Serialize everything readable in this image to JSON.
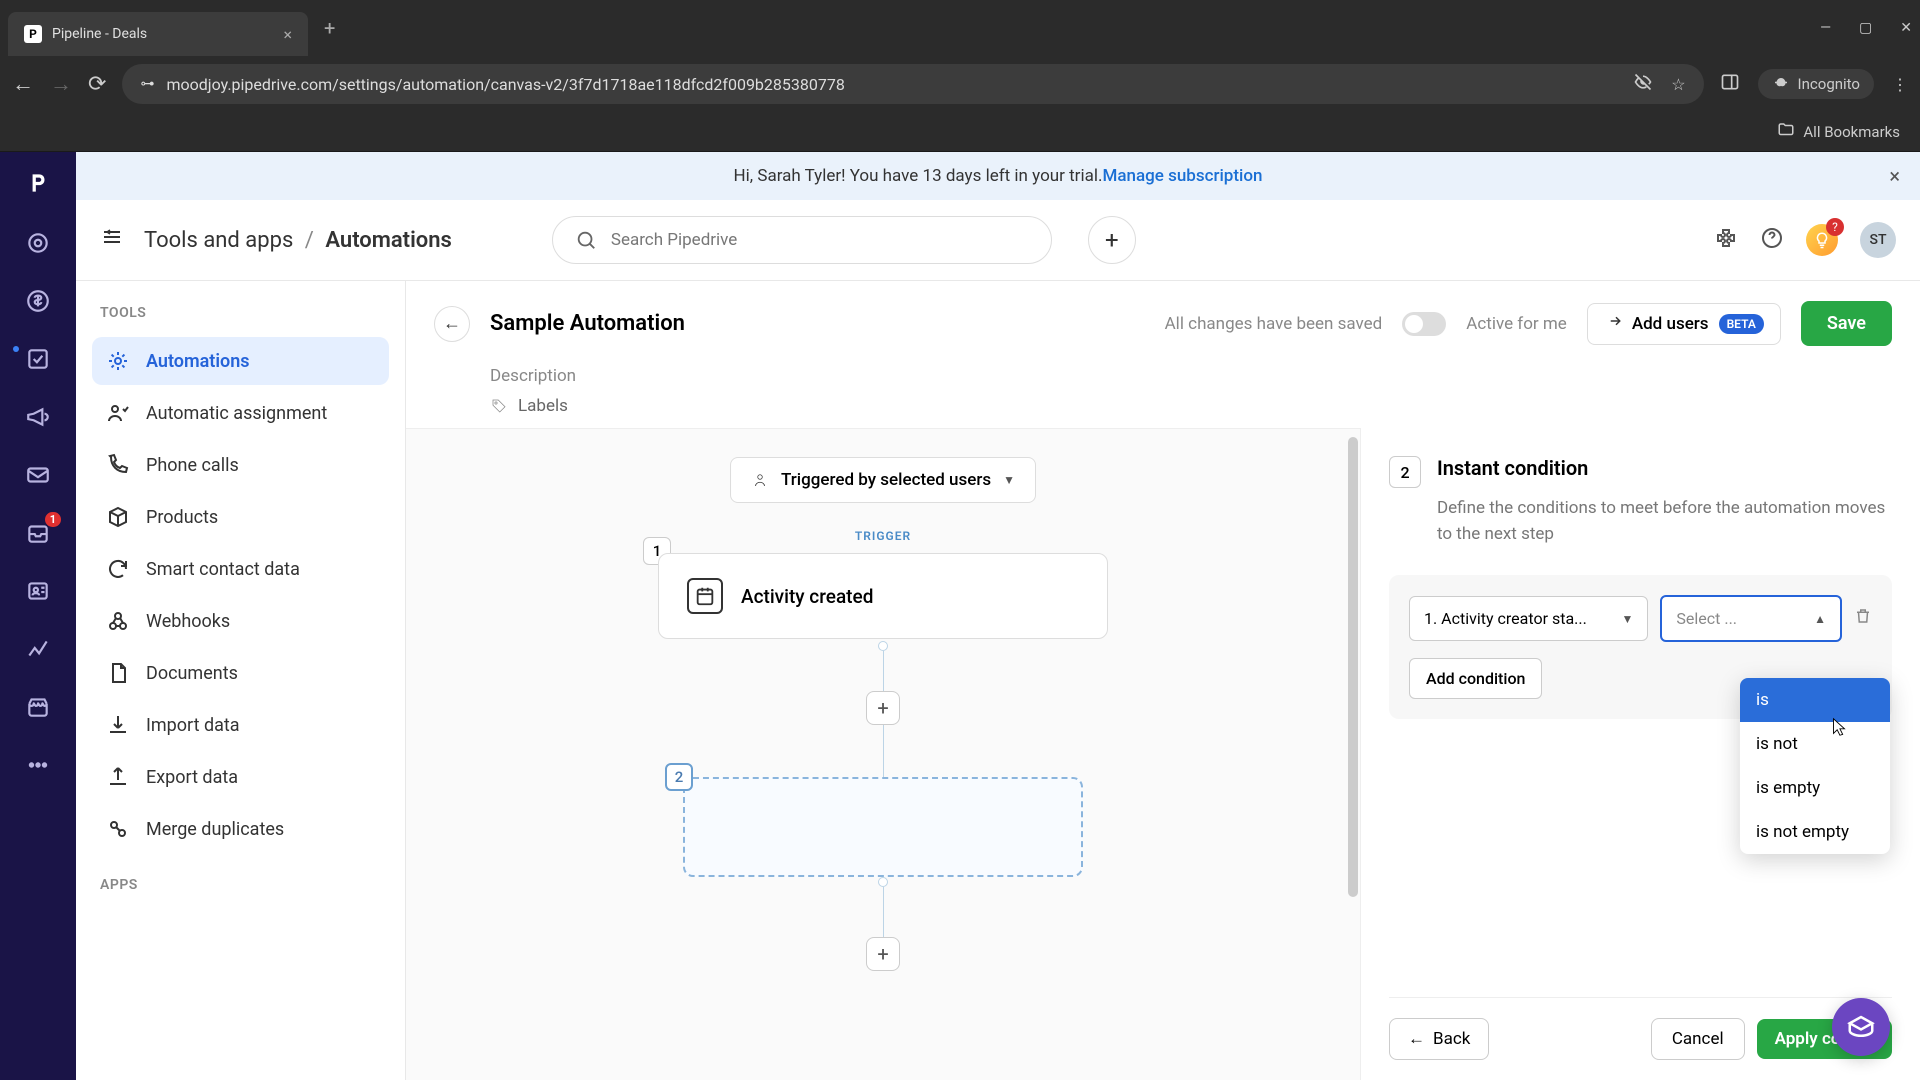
{
  "browser": {
    "tab_title": "Pipeline - Deals",
    "tab_favicon": "P",
    "url": "moodjoy.pipedrive.com/settings/automation/canvas-v2/3f7d1718ae118dfcd2f009b285380778",
    "incognito_label": "Incognito",
    "bookmarks_label": "All Bookmarks"
  },
  "banner": {
    "text_prefix": "Hi, Sarah Tyler! You have 13 days left in your trial. ",
    "link": "Manage subscription"
  },
  "topbar": {
    "breadcrumb_parent": "Tools and apps",
    "breadcrumb_current": "Automations",
    "search_placeholder": "Search Pipedrive",
    "avatar": "ST",
    "notif_badge": "?"
  },
  "sidebar": {
    "heading_tools": "TOOLS",
    "heading_apps": "APPS",
    "items": [
      "Automations",
      "Automatic assignment",
      "Phone calls",
      "Products",
      "Smart contact data",
      "Webhooks",
      "Documents",
      "Import data",
      "Export data",
      "Merge duplicates"
    ]
  },
  "automation": {
    "title": "Sample Automation",
    "description_placeholder": "Description",
    "labels": "Labels",
    "saved": "All changes have been saved",
    "active_label": "Active for me",
    "add_users": "Add users",
    "beta": "BETA",
    "save": "Save"
  },
  "canvas": {
    "trigger_by": "Triggered by selected users",
    "trigger_label": "TRIGGER",
    "step1_num": "1",
    "step1_text": "Activity created",
    "step2_num": "2"
  },
  "panel": {
    "num": "2",
    "title": "Instant condition",
    "desc": "Define the conditions to meet before the automation moves to the next step",
    "field_value": "1. Activity creator sta...",
    "operator_placeholder": "Select ...",
    "add_condition": "Add condition",
    "dropdown": [
      "is",
      "is not",
      "is empty",
      "is not empty"
    ],
    "back": "Back",
    "cancel": "Cancel",
    "apply": "Apply cond..."
  },
  "rail_badge": "1"
}
